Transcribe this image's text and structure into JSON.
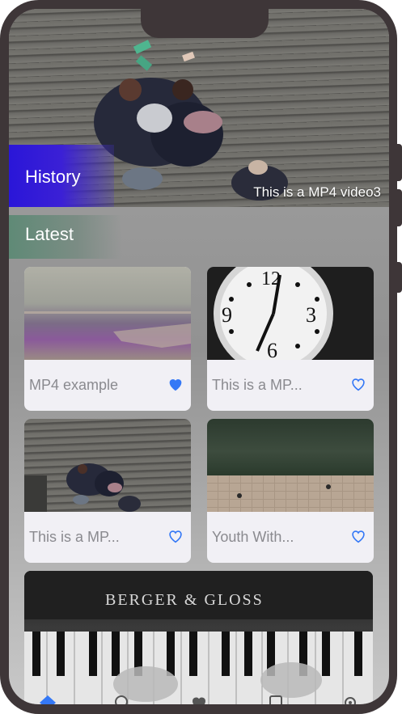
{
  "hero": {
    "section_label": "History",
    "caption": "This is a MP4 video3"
  },
  "latest": {
    "section_label": "Latest"
  },
  "cards": [
    {
      "title": "MP4 example",
      "favorited": true
    },
    {
      "title": "This is a MP...",
      "favorited": false
    },
    {
      "title": "This is a MP...",
      "favorited": false
    },
    {
      "title": "Youth With...",
      "favorited": false
    }
  ],
  "featured": {
    "brand_text": "BERGER & GLOSS"
  },
  "tabbar": {
    "icons": [
      "home-icon",
      "search-icon",
      "heart-icon",
      "document-icon",
      "gear-icon"
    ]
  },
  "colors": {
    "accent": "#3478f6",
    "history_tab": "#2a16d8",
    "latest_tab": "#5f8a76"
  }
}
